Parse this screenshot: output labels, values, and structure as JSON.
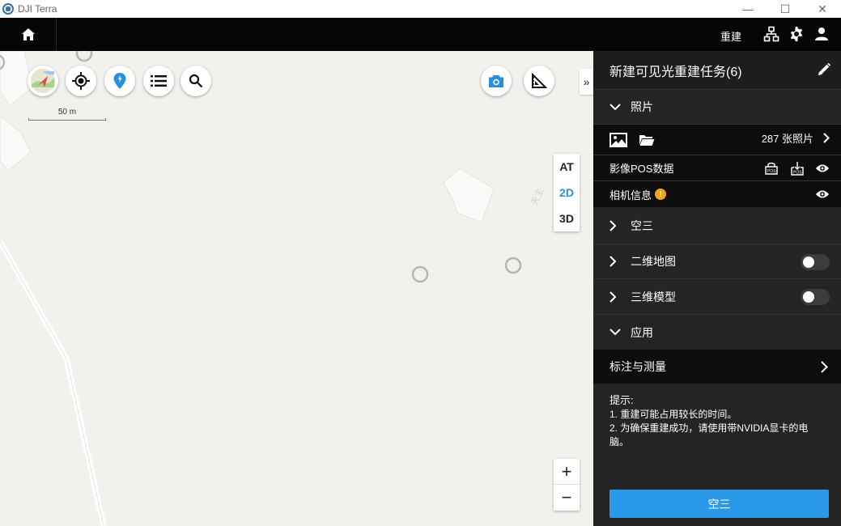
{
  "window": {
    "title": "DJI Terra",
    "minimize": "—",
    "maximize": "☐",
    "close": "✕"
  },
  "topnav": {
    "rebuild_label": "重建"
  },
  "map": {
    "scale_label": "50 m",
    "view_modes": [
      "AT",
      "2D",
      "3D"
    ],
    "active_view": "2D",
    "zoom_in": "+",
    "zoom_out": "−",
    "expand": "»",
    "road_label": "天主"
  },
  "panel": {
    "title": "新建可见光重建任务(6)",
    "photos": {
      "section_label": "照片",
      "count_label": "287 张照片",
      "pos_label": "影像POS数据",
      "camera_label": "相机信息",
      "warn_mark": "!"
    },
    "sections": {
      "at_label": "空三",
      "map2d_label": "二维地图",
      "model3d_label": "三维模型",
      "apply_label": "应用"
    },
    "measure_label": "标注与测量",
    "tips": {
      "title": "提示:",
      "line1": "1. 重建可能占用较长的时间。",
      "line2": "2. 为确保重建成功，请使用带NVIDIA显卡的电脑。"
    },
    "primary_button": "空三"
  },
  "colors": {
    "accent": "#2a99e8",
    "panel_bg": "#242424",
    "map_bg": "#f2f1ed",
    "warn": "#f2a50e"
  }
}
